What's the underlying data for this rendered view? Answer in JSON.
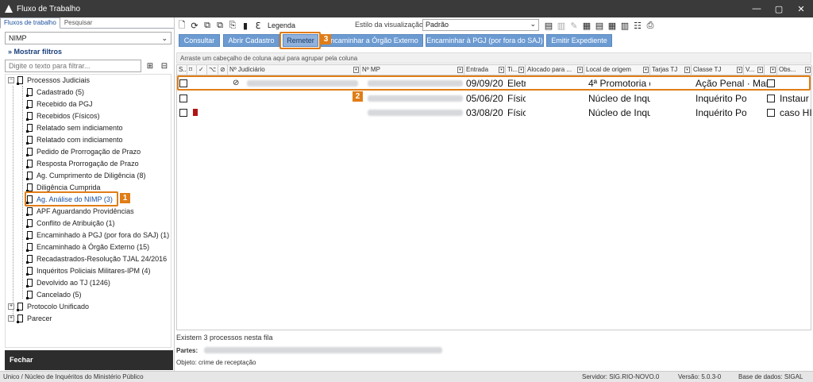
{
  "window": {
    "title": "Fluxo de Trabalho",
    "minimize": "—",
    "maximize": "▢",
    "close": "✕"
  },
  "left_tabs": [
    "Fluxos de trabalho",
    "Pesquisar"
  ],
  "flow_select": "NIMP",
  "show_filters": "Mostrar filtros",
  "filter_placeholder": "Digite o texto para filtrar...",
  "tree": {
    "root1": "Processos Judiciais",
    "items": [
      "Cadastrado (5)",
      "Recebido da PGJ",
      "Recebidos (Físicos)",
      "Relatado sem indiciamento",
      "Relatado com indiciamento",
      "Pedido de Prorrogação de Prazo",
      "Resposta Prorrogação de Prazo",
      "Ag. Cumprimento de Diligência (8)",
      "Diligência Cumprida",
      "Ag. Análise do NIMP (3)",
      "APF Aguardando Providências",
      "Conflito de Atribuição (1)",
      "Encaminhado à PGJ (por fora do SAJ) (1)",
      "Encaminhado à Órgão Externo (15)",
      "Recadastrados-Resolução TJAL 24/2016",
      "Inquéritos Policiais Militares-IPM (4)",
      "Devolvido ao TJ (1246)",
      "Cancelado (5)"
    ],
    "root2": "Protocolo Unificado",
    "root3": "Parecer",
    "expand_open": "−",
    "expand_closed": "+"
  },
  "close_label": "Fechar",
  "toolbar": {
    "legend": "Legenda",
    "style_label": "Estilo da visualização",
    "style_value": "Padrão"
  },
  "actions": [
    "Consultar",
    "Abrir Cadastro",
    "Remeter",
    "Encaminhar a Órgão Externo",
    "Encaminhar à PGJ (por fora do SAJ)",
    "Emitir Expediente"
  ],
  "group_hint": "Arraste um cabeçalho de coluna aqui para agrupar pela coluna",
  "columns": [
    "S...",
    "",
    "",
    "",
    "",
    "Nº Judiciário",
    "Nº MP",
    "Entrada",
    "Ti...",
    "Alocado para ...",
    "Local de origem",
    "Tarjas TJ",
    "Classe TJ",
    "V...",
    "",
    "Obs..."
  ],
  "rows": [
    {
      "entrada": "09/09/20",
      "tipo": "Eletr",
      "local": "4ª Promotoria d",
      "classe": "Ação Penal · Man",
      "obs": ""
    },
    {
      "entrada": "05/06/20",
      "tipo": "Físic",
      "local": "Núcleo de Inque",
      "classe": "Inquérito Po",
      "obs": "Instaur"
    },
    {
      "entrada": "03/08/20",
      "tipo": "Físic",
      "local": "Núcleo de Inque",
      "classe": "Inquérito Po",
      "obs": "caso HI"
    }
  ],
  "footer": {
    "count": "Existem 3 processos nesta fila",
    "parts_label": "Partes:",
    "object": "Objeto: crime de receptação"
  },
  "status": {
    "left": "Unico / Núcleo de Inquéritos do Ministério Público",
    "server": "Servidor: SIG.RIO-NOVO.0",
    "version": "Versão: 5.0.3-0",
    "db": "Base de dados: SIGAL"
  },
  "annotations": [
    "1",
    "2",
    "3"
  ],
  "colors": {
    "accent": "#e07d16",
    "button": "#6c9bd2",
    "titlebar": "#3a3a3a"
  }
}
